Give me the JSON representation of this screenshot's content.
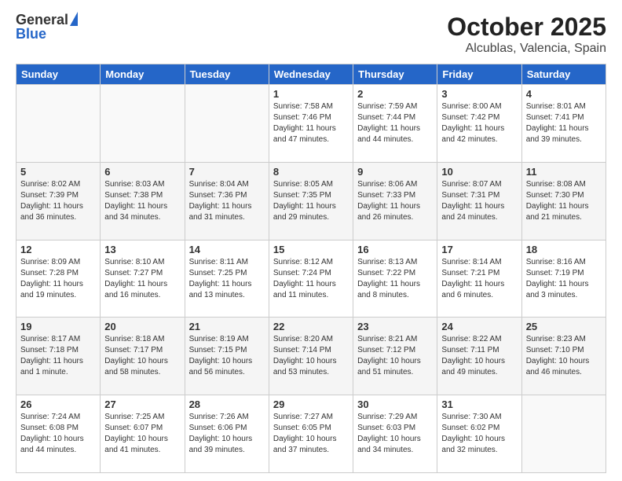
{
  "header": {
    "logo_line1": "General",
    "logo_line2": "Blue",
    "title": "October 2025",
    "subtitle": "Alcublas, Valencia, Spain"
  },
  "days_of_week": [
    "Sunday",
    "Monday",
    "Tuesday",
    "Wednesday",
    "Thursday",
    "Friday",
    "Saturday"
  ],
  "weeks": [
    [
      {
        "date": "",
        "info": ""
      },
      {
        "date": "",
        "info": ""
      },
      {
        "date": "",
        "info": ""
      },
      {
        "date": "1",
        "info": "Sunrise: 7:58 AM\nSunset: 7:46 PM\nDaylight: 11 hours and 47 minutes."
      },
      {
        "date": "2",
        "info": "Sunrise: 7:59 AM\nSunset: 7:44 PM\nDaylight: 11 hours and 44 minutes."
      },
      {
        "date": "3",
        "info": "Sunrise: 8:00 AM\nSunset: 7:42 PM\nDaylight: 11 hours and 42 minutes."
      },
      {
        "date": "4",
        "info": "Sunrise: 8:01 AM\nSunset: 7:41 PM\nDaylight: 11 hours and 39 minutes."
      }
    ],
    [
      {
        "date": "5",
        "info": "Sunrise: 8:02 AM\nSunset: 7:39 PM\nDaylight: 11 hours and 36 minutes."
      },
      {
        "date": "6",
        "info": "Sunrise: 8:03 AM\nSunset: 7:38 PM\nDaylight: 11 hours and 34 minutes."
      },
      {
        "date": "7",
        "info": "Sunrise: 8:04 AM\nSunset: 7:36 PM\nDaylight: 11 hours and 31 minutes."
      },
      {
        "date": "8",
        "info": "Sunrise: 8:05 AM\nSunset: 7:35 PM\nDaylight: 11 hours and 29 minutes."
      },
      {
        "date": "9",
        "info": "Sunrise: 8:06 AM\nSunset: 7:33 PM\nDaylight: 11 hours and 26 minutes."
      },
      {
        "date": "10",
        "info": "Sunrise: 8:07 AM\nSunset: 7:31 PM\nDaylight: 11 hours and 24 minutes."
      },
      {
        "date": "11",
        "info": "Sunrise: 8:08 AM\nSunset: 7:30 PM\nDaylight: 11 hours and 21 minutes."
      }
    ],
    [
      {
        "date": "12",
        "info": "Sunrise: 8:09 AM\nSunset: 7:28 PM\nDaylight: 11 hours and 19 minutes."
      },
      {
        "date": "13",
        "info": "Sunrise: 8:10 AM\nSunset: 7:27 PM\nDaylight: 11 hours and 16 minutes."
      },
      {
        "date": "14",
        "info": "Sunrise: 8:11 AM\nSunset: 7:25 PM\nDaylight: 11 hours and 13 minutes."
      },
      {
        "date": "15",
        "info": "Sunrise: 8:12 AM\nSunset: 7:24 PM\nDaylight: 11 hours and 11 minutes."
      },
      {
        "date": "16",
        "info": "Sunrise: 8:13 AM\nSunset: 7:22 PM\nDaylight: 11 hours and 8 minutes."
      },
      {
        "date": "17",
        "info": "Sunrise: 8:14 AM\nSunset: 7:21 PM\nDaylight: 11 hours and 6 minutes."
      },
      {
        "date": "18",
        "info": "Sunrise: 8:16 AM\nSunset: 7:19 PM\nDaylight: 11 hours and 3 minutes."
      }
    ],
    [
      {
        "date": "19",
        "info": "Sunrise: 8:17 AM\nSunset: 7:18 PM\nDaylight: 11 hours and 1 minute."
      },
      {
        "date": "20",
        "info": "Sunrise: 8:18 AM\nSunset: 7:17 PM\nDaylight: 10 hours and 58 minutes."
      },
      {
        "date": "21",
        "info": "Sunrise: 8:19 AM\nSunset: 7:15 PM\nDaylight: 10 hours and 56 minutes."
      },
      {
        "date": "22",
        "info": "Sunrise: 8:20 AM\nSunset: 7:14 PM\nDaylight: 10 hours and 53 minutes."
      },
      {
        "date": "23",
        "info": "Sunrise: 8:21 AM\nSunset: 7:12 PM\nDaylight: 10 hours and 51 minutes."
      },
      {
        "date": "24",
        "info": "Sunrise: 8:22 AM\nSunset: 7:11 PM\nDaylight: 10 hours and 49 minutes."
      },
      {
        "date": "25",
        "info": "Sunrise: 8:23 AM\nSunset: 7:10 PM\nDaylight: 10 hours and 46 minutes."
      }
    ],
    [
      {
        "date": "26",
        "info": "Sunrise: 7:24 AM\nSunset: 6:08 PM\nDaylight: 10 hours and 44 minutes."
      },
      {
        "date": "27",
        "info": "Sunrise: 7:25 AM\nSunset: 6:07 PM\nDaylight: 10 hours and 41 minutes."
      },
      {
        "date": "28",
        "info": "Sunrise: 7:26 AM\nSunset: 6:06 PM\nDaylight: 10 hours and 39 minutes."
      },
      {
        "date": "29",
        "info": "Sunrise: 7:27 AM\nSunset: 6:05 PM\nDaylight: 10 hours and 37 minutes."
      },
      {
        "date": "30",
        "info": "Sunrise: 7:29 AM\nSunset: 6:03 PM\nDaylight: 10 hours and 34 minutes."
      },
      {
        "date": "31",
        "info": "Sunrise: 7:30 AM\nSunset: 6:02 PM\nDaylight: 10 hours and 32 minutes."
      },
      {
        "date": "",
        "info": ""
      }
    ]
  ]
}
